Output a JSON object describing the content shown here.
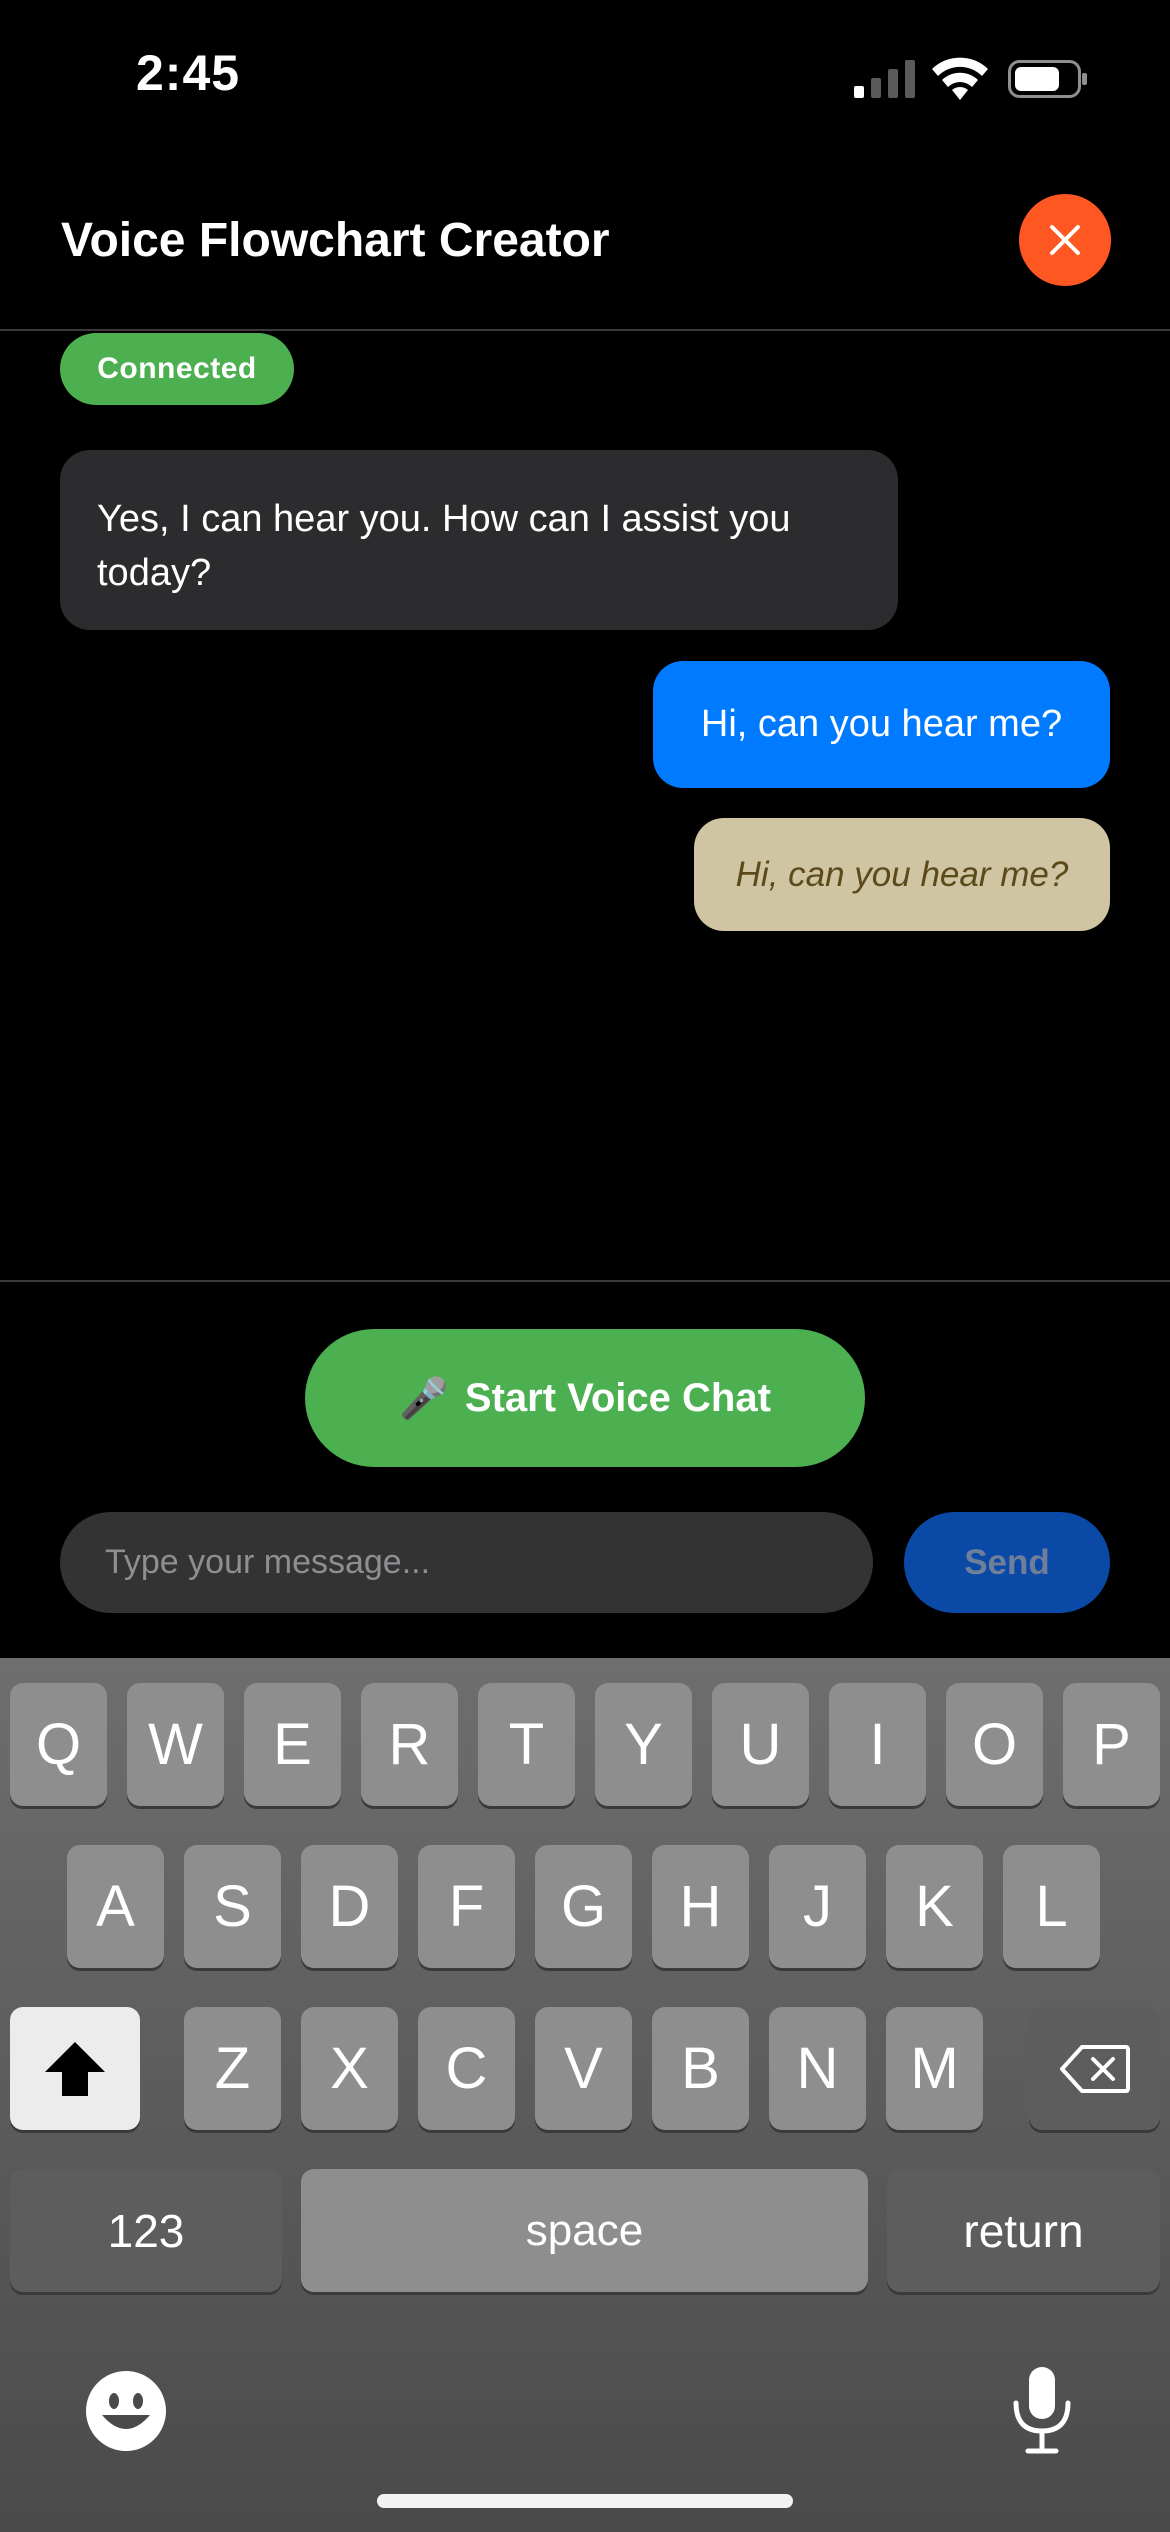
{
  "status_bar": {
    "time": "2:45"
  },
  "header": {
    "title": "Voice Flowchart Creator"
  },
  "connection": {
    "status": "Connected"
  },
  "messages": [
    {
      "role": "assistant",
      "text": "Yes, I can hear you. How can I assist you today?"
    },
    {
      "role": "user",
      "text": "Hi, can you hear me?"
    },
    {
      "role": "transcript",
      "text": "Hi, can you hear me?"
    }
  ],
  "controls": {
    "voice_button_label": "Start Voice Chat",
    "voice_button_icon": "🎤",
    "input_placeholder": "Type your message...",
    "input_value": "",
    "send_label": "Send"
  },
  "keyboard": {
    "row1": [
      "Q",
      "W",
      "E",
      "R",
      "T",
      "Y",
      "U",
      "I",
      "O",
      "P"
    ],
    "row2": [
      "A",
      "S",
      "D",
      "F",
      "G",
      "H",
      "J",
      "K",
      "L"
    ],
    "row3": [
      "Z",
      "X",
      "C",
      "V",
      "B",
      "N",
      "M"
    ],
    "numbers_label": "123",
    "space_label": "space",
    "return_label": "return"
  },
  "colors": {
    "close_button": "#ff5722",
    "connected": "#4caf50",
    "user_bubble": "#007aff",
    "transcript_bubble": "#cfc5a3",
    "send_button": "#0a4aa6"
  }
}
